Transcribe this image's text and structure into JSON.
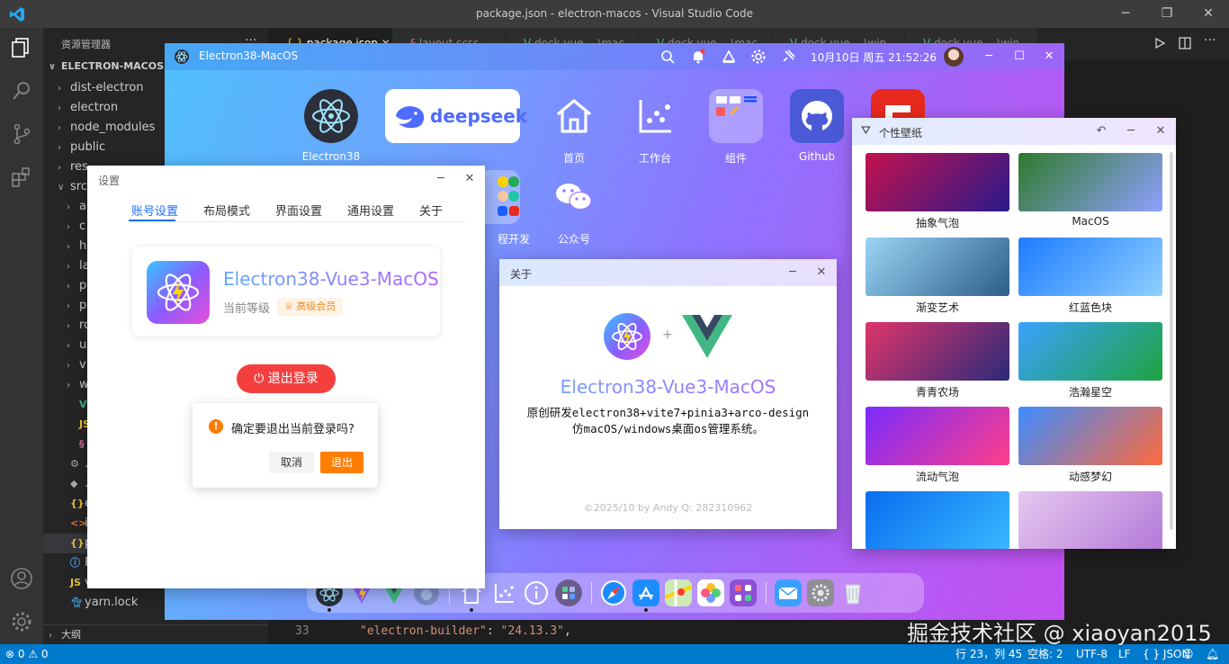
{
  "vscode": {
    "title": "package.json - electron-macos - Visual Studio Code",
    "explorer": {
      "title": "资源管理器",
      "more": "···",
      "root": "ELECTRON-MACOS",
      "items": [
        {
          "label": "dist-electron",
          "kind": "folder"
        },
        {
          "label": "electron",
          "kind": "folder"
        },
        {
          "label": "node_modules",
          "kind": "folder"
        },
        {
          "label": "public",
          "kind": "folder"
        },
        {
          "label": "res",
          "kind": "folder"
        },
        {
          "label": "src",
          "kind": "folder-open"
        },
        {
          "label": "a",
          "kind": "subfolder"
        },
        {
          "label": "c",
          "kind": "subfolder"
        },
        {
          "label": "h",
          "kind": "subfolder"
        },
        {
          "label": "la",
          "kind": "subfolder"
        },
        {
          "label": "p",
          "kind": "subfolder"
        },
        {
          "label": "p",
          "kind": "subfolder"
        },
        {
          "label": "ro",
          "kind": "subfolder"
        },
        {
          "label": "u",
          "kind": "subfolder"
        },
        {
          "label": "v",
          "kind": "subfolder"
        },
        {
          "label": "w",
          "kind": "subfolder"
        },
        {
          "label": "A",
          "kind": "vue"
        },
        {
          "label": "m",
          "kind": "js"
        },
        {
          "label": "st",
          "kind": "scss"
        },
        {
          "label": ".en",
          "kind": "gear"
        },
        {
          "label": ".gi",
          "kind": "git"
        },
        {
          "label": "ele",
          "kind": "json"
        },
        {
          "label": "ind",
          "kind": "html"
        },
        {
          "label": "pa",
          "kind": "json"
        },
        {
          "label": "RE",
          "kind": "info"
        },
        {
          "label": "vite.config.js",
          "kind": "js"
        },
        {
          "label": "yarn.lock",
          "kind": "yarn"
        }
      ],
      "outline": "大纲"
    },
    "tabs": [
      {
        "label": "package.json",
        "active": true
      },
      {
        "label": "layout.scss"
      },
      {
        "label": "dock.vue …\\mac"
      },
      {
        "label": "dock.vue …\\mac"
      },
      {
        "label": "dock.vue …\\win"
      },
      {
        "label": "dock.vue …\\win"
      }
    ],
    "code": {
      "line_number": "33",
      "key": "\"electron-builder\"",
      "value": "\"24.13.3\""
    },
    "status": {
      "left": "⊗ 0 ⚠ 0",
      "position": "行 23，列 45",
      "spaces": "空格: 2",
      "encoding": "UTF-8",
      "eol": "LF",
      "language": "{ } JSON"
    },
    "watermark": "掘金技术社区 @ xiaoyan2015"
  },
  "desk": {
    "title": "Electron38-MacOS",
    "clock": "10月10日 周五 21:52:26",
    "icons": [
      {
        "label": "Electron38"
      },
      {
        "label": "deepseek"
      },
      {
        "label": "首页"
      },
      {
        "label": "工作台"
      },
      {
        "label": "组件"
      },
      {
        "label": "Github"
      },
      {
        "label": ""
      },
      {
        "label": "程开发"
      },
      {
        "label": "公众号"
      }
    ]
  },
  "settings": {
    "title": "设置",
    "tabs": [
      "账号设置",
      "布局模式",
      "界面设置",
      "通用设置",
      "关于"
    ],
    "profile": {
      "name": "Electron38-Vue3-MacOS",
      "level_label": "当前等级",
      "badge": "高级会员"
    },
    "logout": "退出登录",
    "confirm": {
      "message": "确定要退出当前登录吗?",
      "cancel": "取消",
      "ok": "退出"
    }
  },
  "about": {
    "title": "关于",
    "plus": "+",
    "name": "Electron38-Vue3-MacOS",
    "desc": "原创研发electron38+vite7+pinia3+arco-design仿macOS/windows桌面os管理系统。",
    "copyright": "©2025/10 by Andy   Q: 282310962"
  },
  "wallpaper": {
    "title": "个性壁纸",
    "items": [
      {
        "label": "抽象气泡",
        "colors": [
          "#c4124f",
          "#2a1a8a"
        ]
      },
      {
        "label": "MacOS",
        "colors": [
          "#2f7a2c",
          "#8fa0ff"
        ]
      },
      {
        "label": "渐变艺术",
        "colors": [
          "#9ad6f5",
          "#2d5d8a"
        ]
      },
      {
        "label": "红蓝色块",
        "colors": [
          "#1d7bff",
          "#8fd0ff"
        ]
      },
      {
        "label": "青青农场",
        "colors": [
          "#e0346a",
          "#2b2a7a"
        ]
      },
      {
        "label": "浩瀚星空",
        "colors": [
          "#3aa2ff",
          "#1ea33f"
        ]
      },
      {
        "label": "流动气泡",
        "colors": [
          "#7a2cff",
          "#ff3d88"
        ]
      },
      {
        "label": "动感梦幻",
        "colors": [
          "#3c8cff",
          "#ff6a3d"
        ]
      },
      {
        "label": "",
        "colors": [
          "#0a6df0",
          "#38b8ff"
        ]
      },
      {
        "label": "",
        "colors": [
          "#e6c7f0",
          "#b47ad8"
        ]
      }
    ]
  },
  "colors": {
    "accent": "#1e6fff",
    "danger": "#f53f3f",
    "warning": "#ff7d00",
    "statusbar": "#007acc"
  }
}
